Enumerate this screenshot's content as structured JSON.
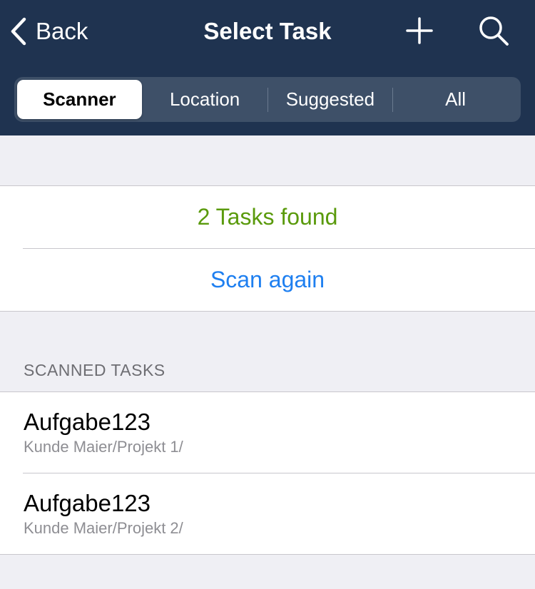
{
  "navbar": {
    "back_label": "Back",
    "title": "Select Task",
    "add_icon": "plus-icon",
    "search_icon": "search-icon"
  },
  "segments": [
    {
      "label": "Scanner",
      "selected": true
    },
    {
      "label": "Location",
      "selected": false
    },
    {
      "label": "Suggested",
      "selected": false
    },
    {
      "label": "All",
      "selected": false
    }
  ],
  "status": {
    "found_text": "2 Tasks found",
    "scan_again_label": "Scan again"
  },
  "scanned_section": {
    "header": "SCANNED TASKS",
    "tasks": [
      {
        "title": "Aufgabe123",
        "subtitle": "Kunde Maier/Projekt 1/"
      },
      {
        "title": "Aufgabe123",
        "subtitle": "Kunde Maier/Projekt 2/"
      }
    ]
  },
  "colors": {
    "navbar_bg": "#1f3350",
    "found_green": "#5a9a0c",
    "link_blue": "#1e7ff0",
    "background": "#efeff4"
  }
}
